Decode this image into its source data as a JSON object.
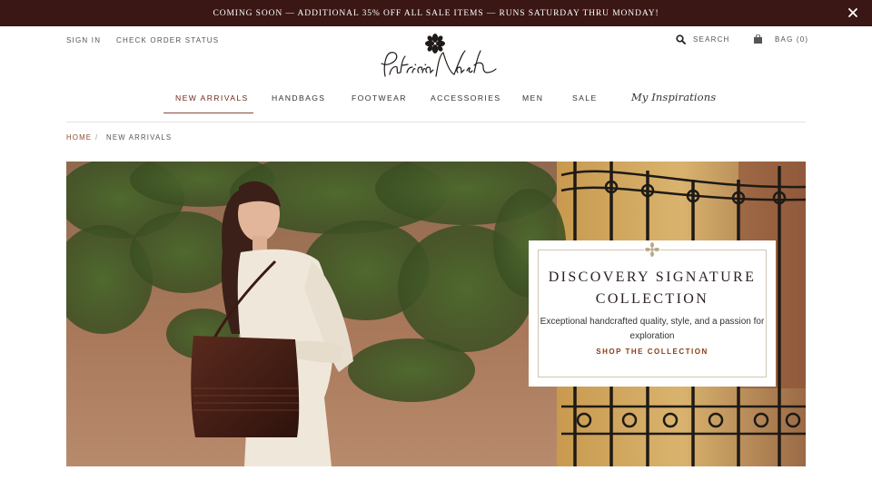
{
  "promo_bar": {
    "text": "COMING SOON — ADDITIONAL 35% OFF ALL SALE ITEMS — RUNS SATURDAY THRU MONDAY!",
    "close_icon": "close-icon"
  },
  "header": {
    "sign_in": "SIGN IN",
    "check_order_status": "CHECK ORDER STATUS",
    "search_label": "SEARCH",
    "search_icon": "search-icon",
    "bag_label": "BAG (0)",
    "bag_icon": "shopping-bag-icon",
    "logo_icon": "patricia-nash-logo"
  },
  "nav": {
    "items": [
      {
        "label": "NEW ARRIVALS",
        "active": true
      },
      {
        "label": "HANDBAGS",
        "active": false
      },
      {
        "label": "FOOTWEAR",
        "active": false
      },
      {
        "label": "ACCESSORIES",
        "active": false
      },
      {
        "label": "MEN",
        "active": false
      },
      {
        "label": "SALE",
        "active": false
      }
    ],
    "inspirations": "My Inspirations"
  },
  "breadcrumb": {
    "home": "HOME",
    "separator": "/",
    "current": "NEW ARRIVALS"
  },
  "hero": {
    "emblem_icon": "flourish-icon",
    "title_line1": "DISCOVERY SIGNATURE",
    "title_line2": "COLLECTION",
    "description": "Exceptional handcrafted quality, style, and a passion for exploration",
    "cta": "SHOP THE COLLECTION"
  },
  "colors": {
    "promo_bg": "#3a1714",
    "accent": "#8a3b14",
    "box_border": "#cfc7b4"
  }
}
